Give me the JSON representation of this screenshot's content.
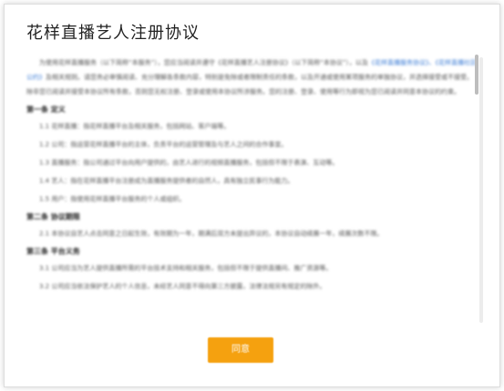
{
  "dialog": {
    "title": "花样直播艺人注册协议",
    "agree_label": "同意"
  },
  "agreement": {
    "intro_before_link": "为使用花样直播服务（以下简称“本服务”），您应当阅读并遵守《花样直播艺人注册协议》（以下简称“本协议”），以及",
    "intro_link": "《花样直播服务协议》、《花样直播社区公约》",
    "intro_after_link": "及相关规则。请您务必审慎阅读、充分理解各条款内容，特别是免除或者限制责任的条款，以及开通或使用某项服务的单独协议，并选择接受或不接受。除非您已阅读并接受本协议所有条款，否则您无权注册、登录或使用本协议所涉服务。您的注册、登录、使用等行为即视为您已阅读并同意本协议的约束。",
    "sections": [
      {
        "heading": "第一条 定义",
        "paragraphs": [
          "1.1 花样直播：指花样直播平台及相关服务，包括网站、客户端等。",
          "1.2 公司：指运营花样直播平台的主体，负责平台的运营管理及与艺人之间的合作事宜。",
          "1.3 直播服务：指公司通过平台向用户提供的，由艺人进行的视频直播服务，包括但不限于表演、互动等。",
          "1.4 艺人：指在花样直播平台注册成为直播服务提供者的自然人，具有独立民事行为能力。",
          "1.5 用户：指使用花样直播平台服务的个人或组织。"
        ]
      },
      {
        "heading": "第二条 协议期限",
        "paragraphs": [
          "2.1 本协议自艺人点击同意之日起生效，有效期为一年，期满后双方未提出异议的，本协议自动续展一年，续展次数不限。"
        ]
      },
      {
        "heading": "第三条 平台义务",
        "paragraphs": [
          "3.1 公司应当为艺人提供直播所需的平台技术支持和相关服务，包括但不限于提供直播间、推广资源等。",
          "3.2 公司应当依法保护艺人的个人信息，未经艺人同意不得向第三方披露，法律法规另有规定的除外。"
        ]
      }
    ]
  }
}
